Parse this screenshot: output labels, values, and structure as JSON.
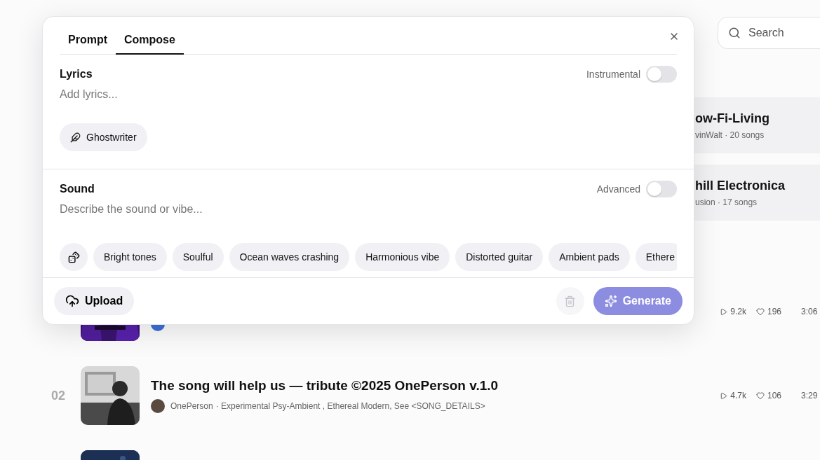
{
  "search": {
    "placeholder": "Search"
  },
  "playlists": [
    {
      "title": "ow-Fi-Living",
      "meta": "vinWalt · 20 songs"
    },
    {
      "title": "hill Electronica",
      "meta": "usion · 17 songs"
    }
  ],
  "songs": [
    {
      "kind": "stage",
      "plays": "9.2k",
      "likes": "196",
      "duration": "3:06"
    },
    {
      "kind": "portrait",
      "number": "02",
      "title": "The song will help us — tribute ©2025 OnePerson v.1.0",
      "artist": "OnePerson",
      "details": "· Experimental Psy-Ambient , Ethereal Modern, See <SONG_DETAILS>",
      "plays": "4.7k",
      "likes": "106",
      "duration": "3:29"
    },
    {
      "kind": "night"
    }
  ],
  "composer": {
    "tabs": [
      {
        "label": "Prompt",
        "selected": false
      },
      {
        "label": "Compose",
        "selected": true
      }
    ],
    "lyrics": {
      "label": "Lyrics",
      "placeholder": "Add lyrics...",
      "toggle": {
        "label": "Instrumental",
        "on": false
      },
      "ghostwriter": "Ghostwriter"
    },
    "sound": {
      "label": "Sound",
      "placeholder": "Describe the sound or vibe...",
      "toggle": {
        "label": "Advanced",
        "on": false
      },
      "tags": [
        "Bright tones",
        "Soulful",
        "Ocean waves crashing",
        "Harmonious vibe",
        "Distorted guitar",
        "Ambient pads",
        "Ethere"
      ]
    },
    "upload": "Upload",
    "clear": {
      "disabled": true
    },
    "generate": "Generate"
  }
}
